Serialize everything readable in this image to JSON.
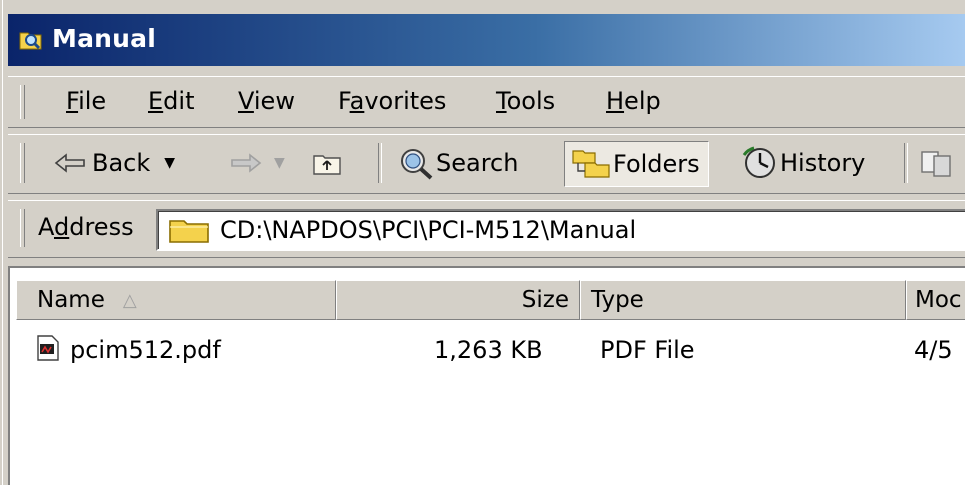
{
  "window": {
    "title": "Manual",
    "title_icon": "folder-magnifier-icon"
  },
  "menu": {
    "items": [
      {
        "pre": "",
        "acc": "F",
        "post": "ile"
      },
      {
        "pre": "",
        "acc": "E",
        "post": "dit"
      },
      {
        "pre": "",
        "acc": "V",
        "post": "iew"
      },
      {
        "pre": "F",
        "acc": "a",
        "post": "vorites"
      },
      {
        "pre": "",
        "acc": "T",
        "post": "ools"
      },
      {
        "pre": "",
        "acc": "H",
        "post": "elp"
      }
    ]
  },
  "toolbar": {
    "back": "Back",
    "search": "Search",
    "folders": "Folders",
    "history": "History"
  },
  "address": {
    "label_pre": "A",
    "label_acc": "d",
    "label_post": "dress",
    "path": "CD:\\NAPDOS\\PCI\\PCI-M512\\Manual"
  },
  "columns": {
    "name": "Name",
    "size": "Size",
    "type": "Type",
    "modified": "Moc"
  },
  "files": [
    {
      "name": "pcim512.pdf",
      "size": "1,263 KB",
      "type": "PDF File",
      "modified": "4/5"
    }
  ],
  "colors": {
    "titlebar_start": "#0a246a",
    "titlebar_end": "#a6caf0",
    "chrome": "#d4d0c8"
  }
}
